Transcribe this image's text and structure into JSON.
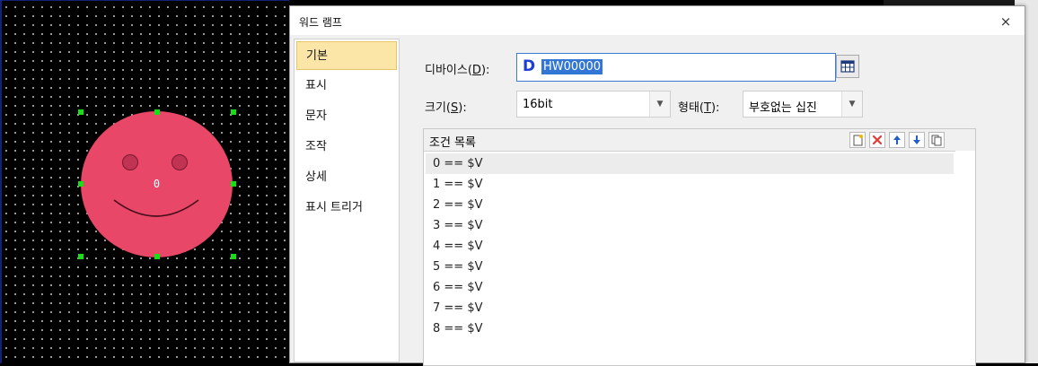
{
  "canvas": {
    "face_value": "0",
    "face_color": "#e94767"
  },
  "dialog": {
    "title": "워드 램프",
    "close": "×",
    "nav": [
      "기본",
      "표시",
      "문자",
      "조작",
      "상세",
      "표시 트리거"
    ],
    "active_nav": "기본",
    "device": {
      "label_main": "디바이스(",
      "label_key": "D",
      "label_end": "):",
      "prefix": "D",
      "value": "HW00000"
    },
    "size": {
      "label_main": "크기(",
      "label_key": "S",
      "label_end": "):",
      "value": "16bit"
    },
    "format": {
      "label_main": "형태(",
      "label_key": "T",
      "label_end": "):",
      "value": "부호없는 십진"
    },
    "condition_list": {
      "title": "조건 목록",
      "rows": [
        "0 == $V",
        "1 == $V",
        "2 == $V",
        "3 == $V",
        "4 == $V",
        "5 == $V",
        "6 == $V",
        "7 == $V",
        "8 == $V"
      ],
      "toolbar": [
        "new-icon",
        "delete-icon",
        "move-up-icon",
        "move-down-icon",
        "copy-icon"
      ]
    },
    "colors": {
      "accent": "#3377d6",
      "selected_nav": "#fbe6a8",
      "delete": "#e53935"
    }
  }
}
